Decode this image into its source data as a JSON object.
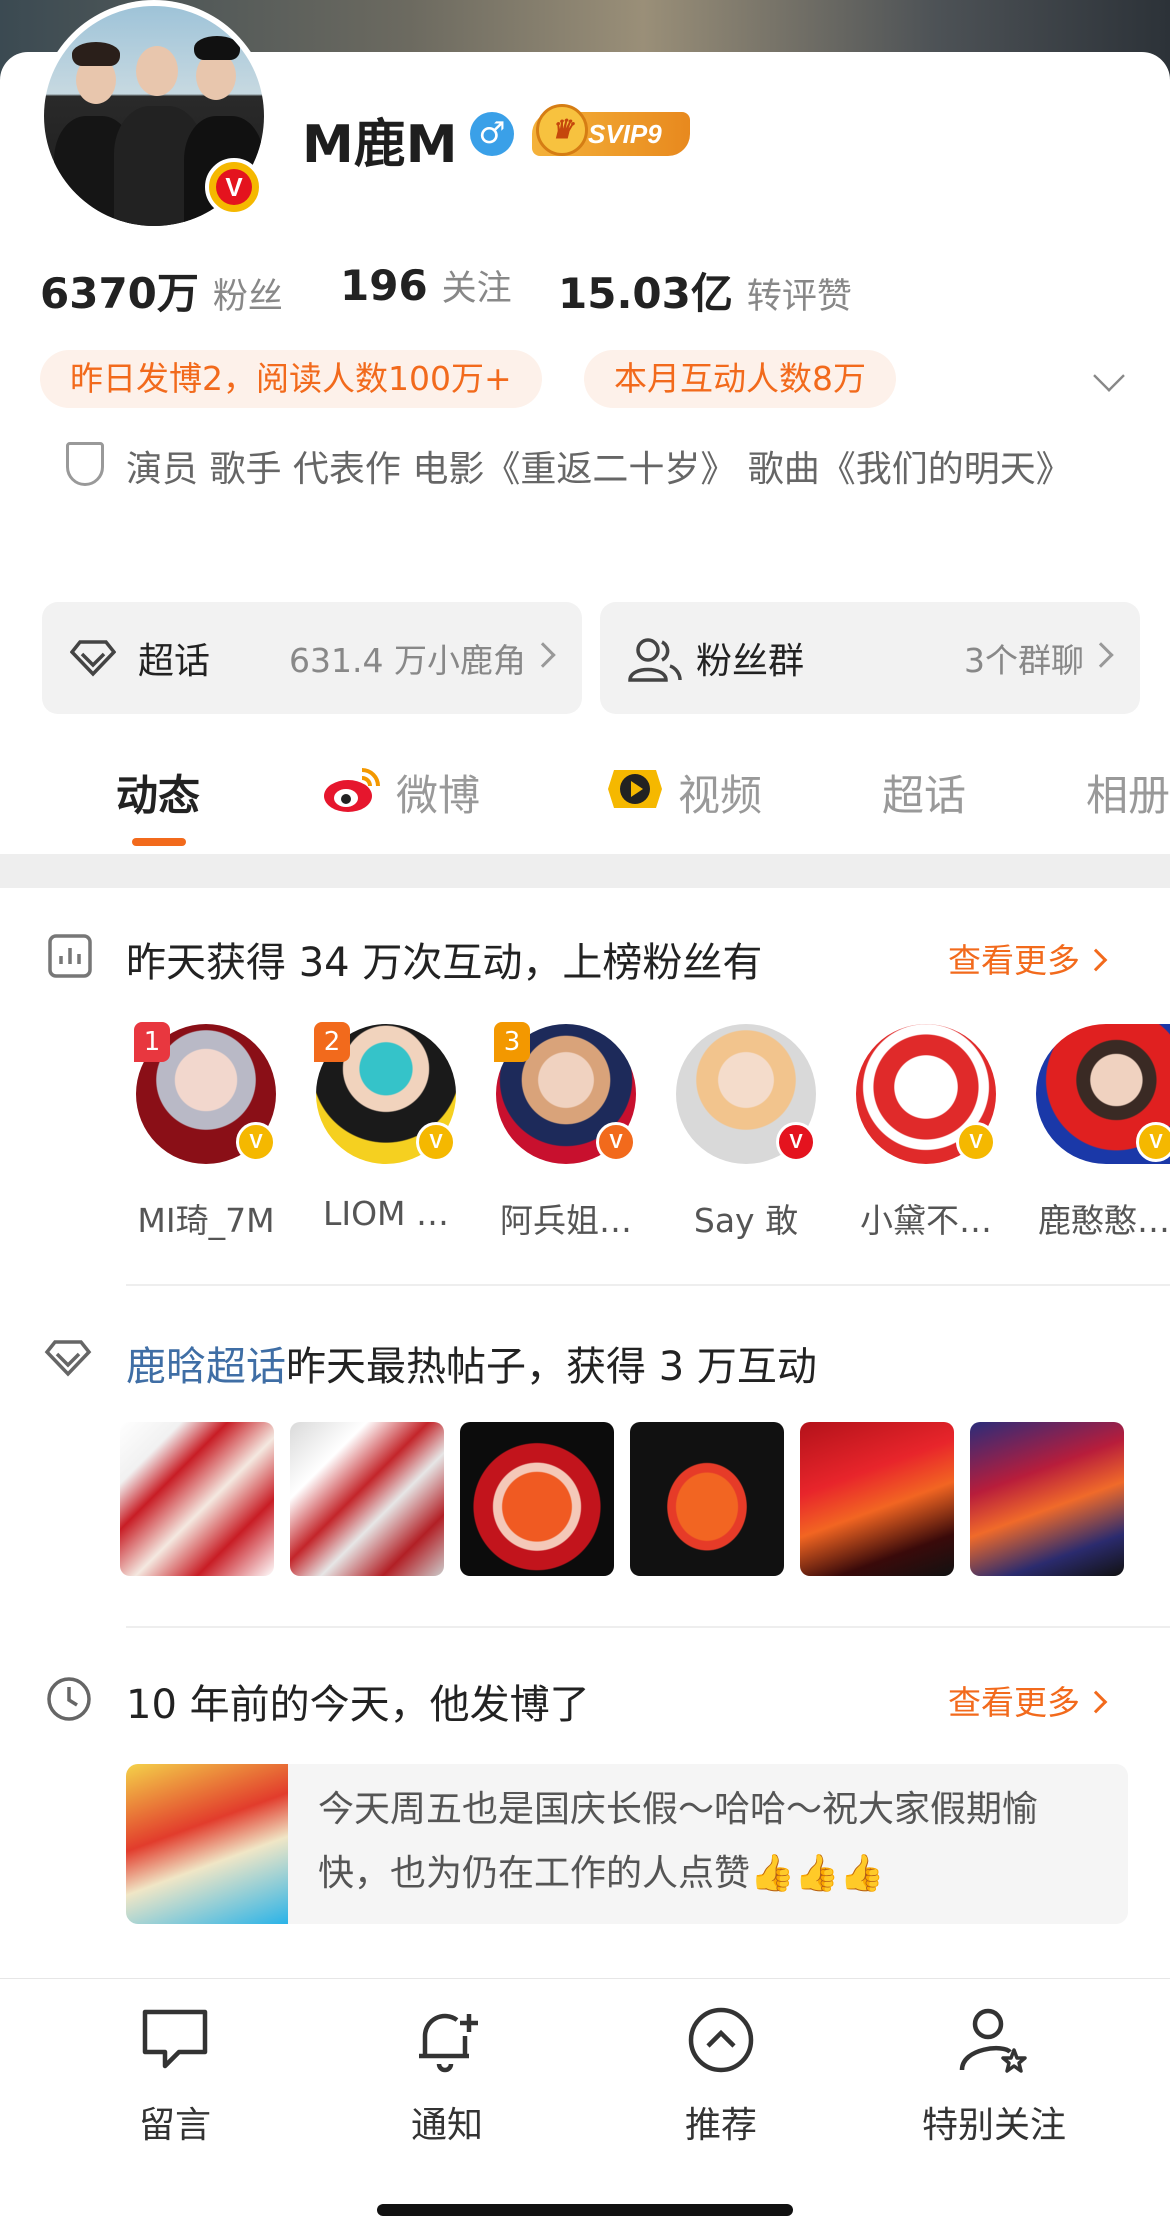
{
  "profile": {
    "name": "M鹿M",
    "gender_symbol": "♂",
    "svip_label": "SVIP9",
    "verified_mark": "V"
  },
  "stats": [
    {
      "value": "6370万",
      "label": "粉丝"
    },
    {
      "value": "196",
      "label": "关注"
    },
    {
      "value": "15.03亿",
      "label": "转评赞"
    }
  ],
  "pills": [
    "昨日发博2，阅读人数100万+",
    "本月互动人数8万"
  ],
  "bio": "演员 歌手 代表作 电影《重返二十岁》 歌曲《我们的明天》",
  "boxes": {
    "supertopic": {
      "label": "超话",
      "value": "631.4 万小鹿角"
    },
    "fan_group": {
      "label": "粉丝群",
      "value": "3个群聊"
    }
  },
  "tabs": [
    "动态",
    "微博",
    "视频",
    "超话",
    "相册"
  ],
  "interaction": {
    "title": "昨天获得 34 万次互动，上榜粉丝有",
    "more": "查看更多",
    "fans": [
      {
        "rank": "1",
        "name": "MI琦_7M",
        "badge": "orange"
      },
      {
        "rank": "2",
        "name": "LIOM …",
        "badge": "orange"
      },
      {
        "rank": "3",
        "name": "阿兵姐…",
        "badge": "orange"
      },
      {
        "rank": "",
        "name": "Say 敢",
        "badge": "red"
      },
      {
        "rank": "",
        "name": "小黛不…",
        "badge": "orange"
      },
      {
        "rank": "",
        "name": "鹿憨憨…",
        "badge": "orange"
      }
    ]
  },
  "hot_post": {
    "link_text": "鹿晗超话",
    "rest": "昨天最热帖子，获得 3 万互动"
  },
  "memory": {
    "title": "10 年前的今天，他发博了",
    "more": "查看更多",
    "text": "今天周五也是国庆长假～哈哈～祝大家假期愉快，也为仍在工作的人点赞👍👍👍"
  },
  "bottom_bar": [
    {
      "label": "留言",
      "icon": "comment-icon"
    },
    {
      "label": "通知",
      "icon": "bell-plus-icon"
    },
    {
      "label": "推荐",
      "icon": "chevron-up-circle-icon"
    },
    {
      "label": "特别关注",
      "icon": "user-star-icon"
    }
  ],
  "colors": {
    "accent": "#f26a1c",
    "link": "#3f6ea5",
    "verified_gold": "#f5b800"
  }
}
